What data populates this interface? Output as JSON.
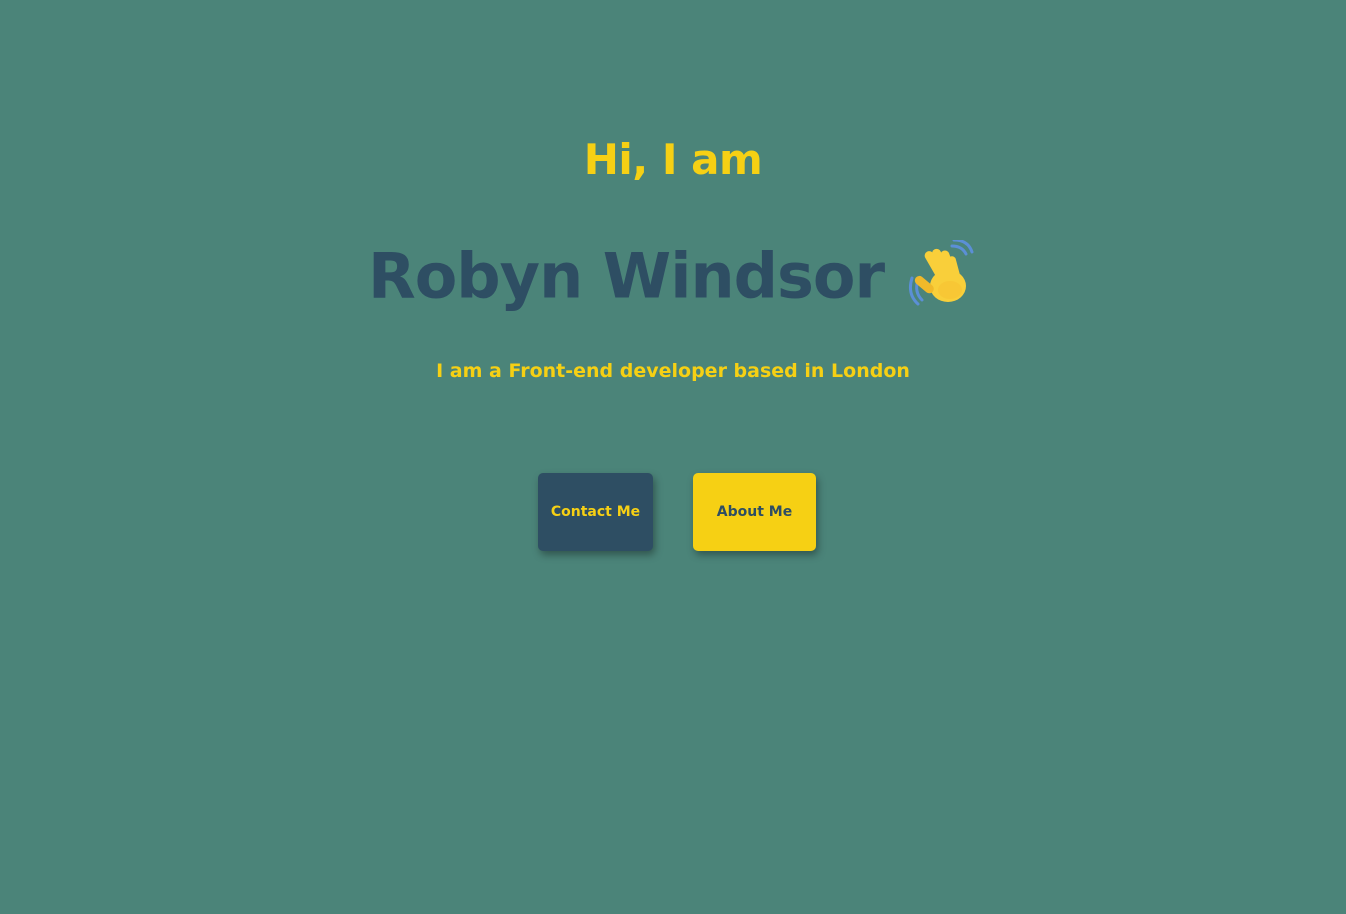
{
  "hero": {
    "greeting": "Hi, I am",
    "name": "Robyn Windsor",
    "wave_icon": "waving-hand-icon",
    "tagline": "I am a Front-end developer based in London"
  },
  "buttons": {
    "contact_label": "Contact Me",
    "about_label": "About Me"
  },
  "colors": {
    "background": "#4b8479",
    "accent_yellow": "#f6d014",
    "dark_slate": "#2e4e63"
  }
}
